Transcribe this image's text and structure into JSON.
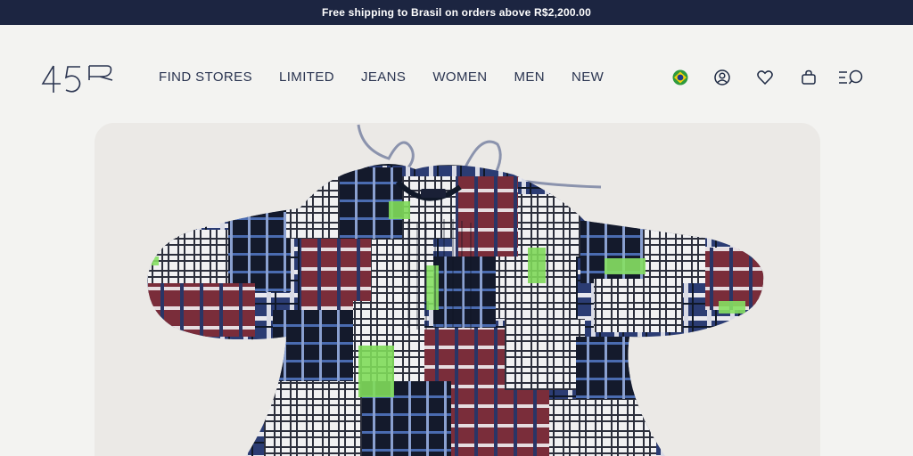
{
  "announcement": {
    "text": "Free shipping to Brasil on orders above R$2,200.00"
  },
  "logo": {
    "text": "45R"
  },
  "nav": [
    {
      "label": "FIND STORES"
    },
    {
      "label": "LIMITED"
    },
    {
      "label": "JEANS"
    },
    {
      "label": "WOMEN"
    },
    {
      "label": "MEN"
    },
    {
      "label": "NEW"
    }
  ],
  "icons": {
    "country_flag": "brazil-flag-icon",
    "account": "user-icon",
    "wishlist": "heart-icon",
    "bag": "shopping-bag-icon",
    "menu_search": "menu-search-icon"
  },
  "colors": {
    "announcement_bg": "#1c2541",
    "page_bg": "#f3f3f1",
    "text": "#2a3450"
  }
}
